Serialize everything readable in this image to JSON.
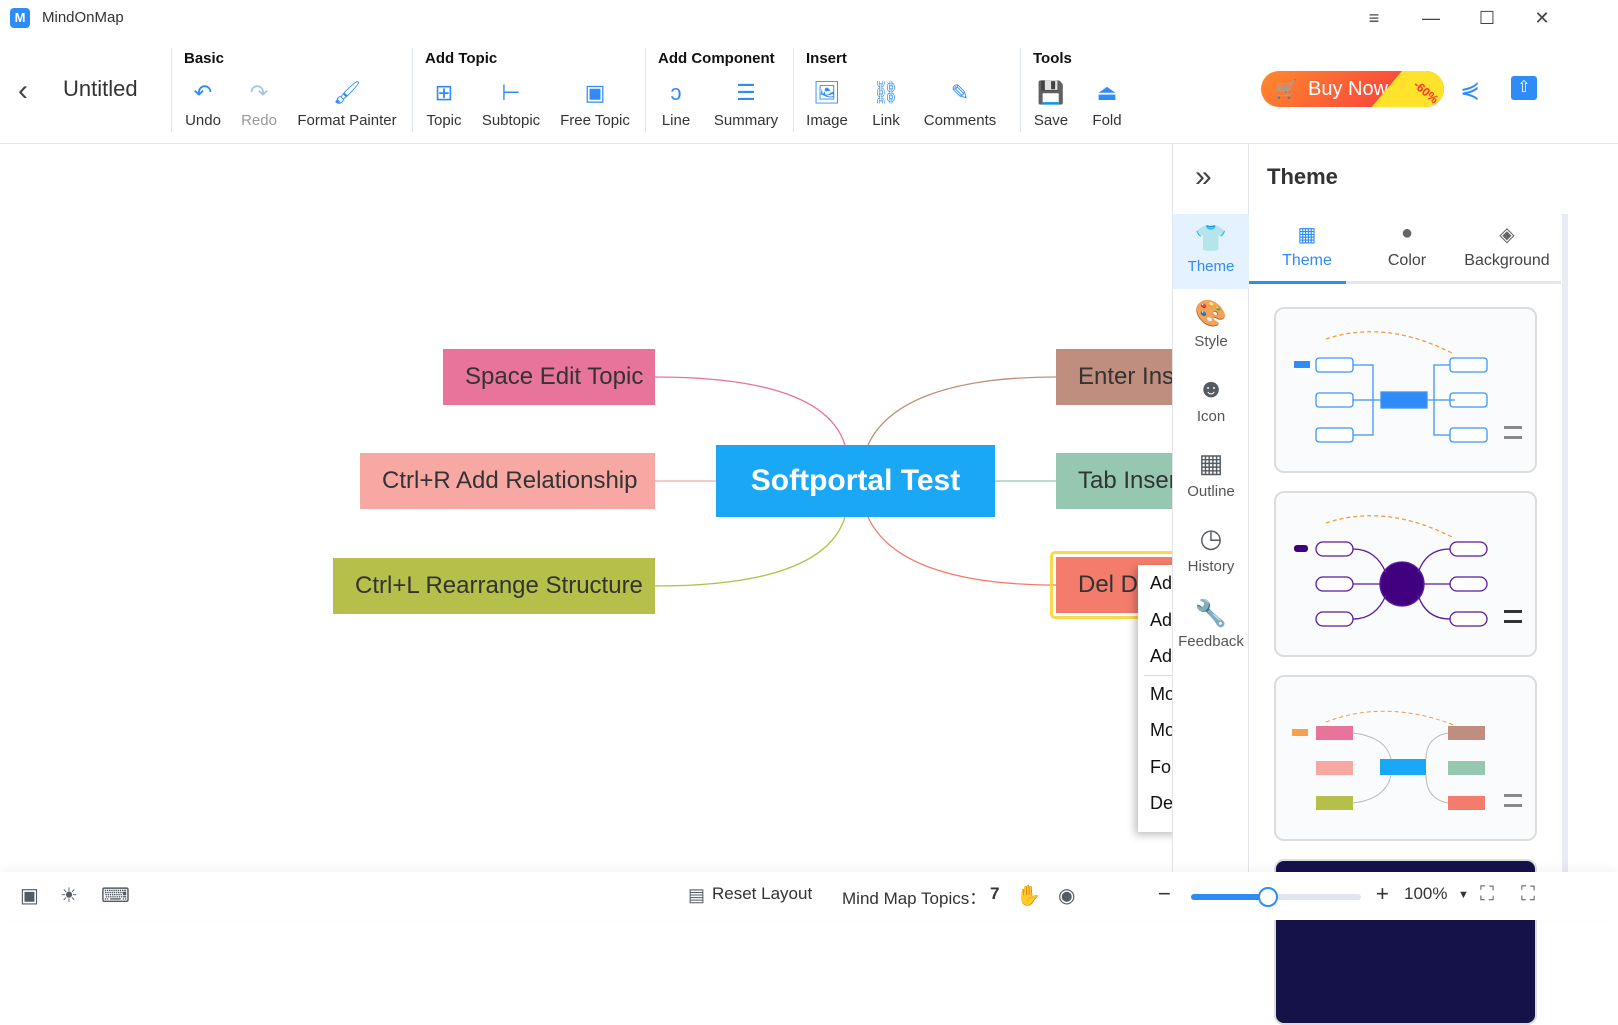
{
  "app": {
    "title": "MindOnMap",
    "logo": "M"
  },
  "window": {
    "menu": "≡",
    "minimize": "—",
    "maximize": "☐",
    "close": "✕"
  },
  "doc": {
    "title": "Untitled"
  },
  "toolbar": {
    "groups": [
      {
        "title": "Basic",
        "tools": [
          {
            "label": "Undo",
            "icon": "undo-icon",
            "glyph": "↶"
          },
          {
            "label": "Redo",
            "icon": "redo-icon",
            "glyph": "↷",
            "disabled": true
          },
          {
            "label": "Format Painter",
            "icon": "brush-icon",
            "glyph": "🖌"
          }
        ]
      },
      {
        "title": "Add Topic",
        "tools": [
          {
            "label": "Topic",
            "icon": "add-topic-icon",
            "glyph": "⊞"
          },
          {
            "label": "Subtopic",
            "icon": "subtopic-icon",
            "glyph": "⊢"
          },
          {
            "label": "Free Topic",
            "icon": "free-topic-icon",
            "glyph": "▣"
          }
        ]
      },
      {
        "title": "Add Component",
        "tools": [
          {
            "label": "Line",
            "icon": "line-icon",
            "glyph": "ↄ"
          },
          {
            "label": "Summary",
            "icon": "summary-icon",
            "glyph": "☰"
          }
        ]
      },
      {
        "title": "Insert",
        "tools": [
          {
            "label": "Image",
            "icon": "image-icon",
            "glyph": "🖼"
          },
          {
            "label": "Link",
            "icon": "link-icon",
            "glyph": "⛓"
          },
          {
            "label": "Comments",
            "icon": "comments-icon",
            "glyph": "✎"
          }
        ]
      },
      {
        "title": "Tools",
        "tools": [
          {
            "label": "Save",
            "icon": "save-icon",
            "glyph": "💾"
          },
          {
            "label": "Fold",
            "icon": "fold-icon",
            "glyph": "⏏"
          }
        ]
      }
    ],
    "buy_now": "Buy Now",
    "discount": "-60%"
  },
  "mindmap": {
    "central": "Softportal Test",
    "left": [
      {
        "text": "Space Edit Topic",
        "color": "#e8749c"
      },
      {
        "text": "Ctrl+R Add Relationship",
        "color": "#f7a8a2"
      },
      {
        "text": "Ctrl+L Rearrange Structure",
        "color": "#b5c04a"
      }
    ],
    "right": [
      {
        "text": "Enter Inse",
        "color": "#c08e7e"
      },
      {
        "text": "Tab Inser",
        "color": "#96c8b1"
      },
      {
        "text": "Del De",
        "color": "#f47c6c",
        "selected": true
      }
    ],
    "context_menu": [
      "Ad",
      "Ad",
      "Ad",
      "Mo",
      "Mo",
      "Fo",
      "De"
    ]
  },
  "sidebar": {
    "items": [
      {
        "label": "Theme",
        "icon": "shirt-icon",
        "glyph": "👕",
        "active": true
      },
      {
        "label": "Style",
        "icon": "palette-icon",
        "glyph": "🎨"
      },
      {
        "label": "Icon",
        "icon": "smiley-icon",
        "glyph": "☻"
      },
      {
        "label": "Outline",
        "icon": "outline-icon",
        "glyph": "▦"
      },
      {
        "label": "History",
        "icon": "clock-icon",
        "glyph": "◷"
      },
      {
        "label": "Feedback",
        "icon": "wrench-icon",
        "glyph": "🔧"
      }
    ],
    "collapse": "»"
  },
  "panel": {
    "title": "Theme",
    "tabs": [
      {
        "label": "Theme",
        "glyph": "▦",
        "active": true
      },
      {
        "label": "Color",
        "glyph": "●"
      },
      {
        "label": "Background",
        "glyph": "◈"
      }
    ]
  },
  "status": {
    "reset_layout": "Reset Layout",
    "topics_label": "Mind Map Topics：",
    "topics_count": "7",
    "zoom": "100%",
    "zoom_percent": 45,
    "minus": "−",
    "plus": "+"
  },
  "colors": {
    "accent": "#2f8cf7",
    "central": "#1aa7f5",
    "selection": "#f9d94a"
  }
}
